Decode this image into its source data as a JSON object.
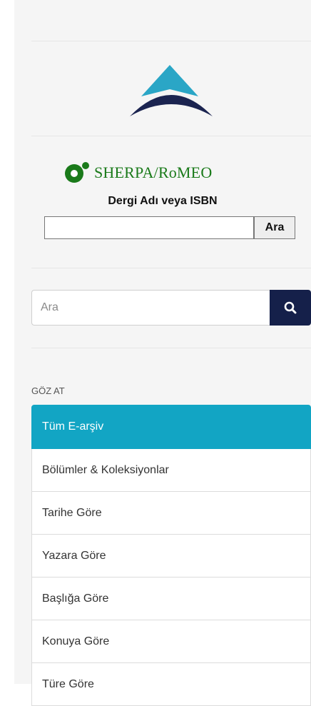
{
  "romeo": {
    "brand": "SHERPA/RoMEO",
    "label": "Dergi Adı veya ISBN",
    "input_value": "",
    "button_label": "Ara"
  },
  "search": {
    "placeholder": "Ara",
    "icon": "search-icon"
  },
  "browse": {
    "heading": "GÖZ AT",
    "items": [
      {
        "label": "Tüm E-arşiv",
        "active": true
      },
      {
        "label": "Bölümler & Koleksiyonlar"
      },
      {
        "label": "Tarihe Göre"
      },
      {
        "label": "Yazara Göre"
      },
      {
        "label": "Başlığa Göre"
      },
      {
        "label": "Konuya Göre"
      },
      {
        "label": "Türe Göre"
      }
    ]
  },
  "colors": {
    "active": "#12a5c4",
    "search_button": "#15204a",
    "sherpa_green": "#1a7a1a"
  }
}
